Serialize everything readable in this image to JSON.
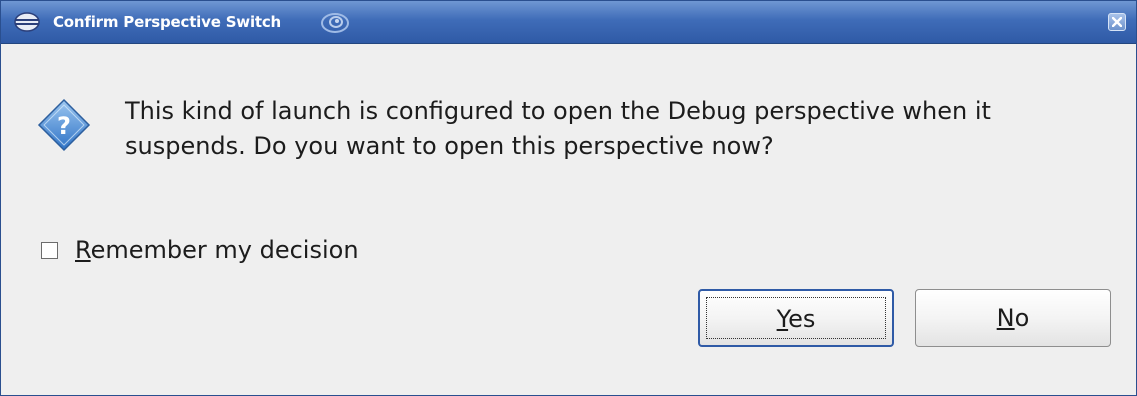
{
  "window": {
    "title": "Confirm Perspective Switch",
    "icons": {
      "app": "eclipse-icon",
      "decoration": "swirl-icon",
      "close": "close-icon"
    },
    "colors": {
      "titlebar": "#3f6cb8",
      "background": "#efefef"
    }
  },
  "dialog": {
    "icon": "question-icon",
    "message": "This kind of launch is configured to open the Debug perspective when it suspends. Do you want to open this perspective now?",
    "remember": {
      "checked": false,
      "mnemonic": "R",
      "label_rest": "emember my decision"
    },
    "buttons": {
      "yes": {
        "mnemonic": "Y",
        "label_rest": "es"
      },
      "no": {
        "mnemonic": "N",
        "label_rest": "o"
      }
    }
  }
}
